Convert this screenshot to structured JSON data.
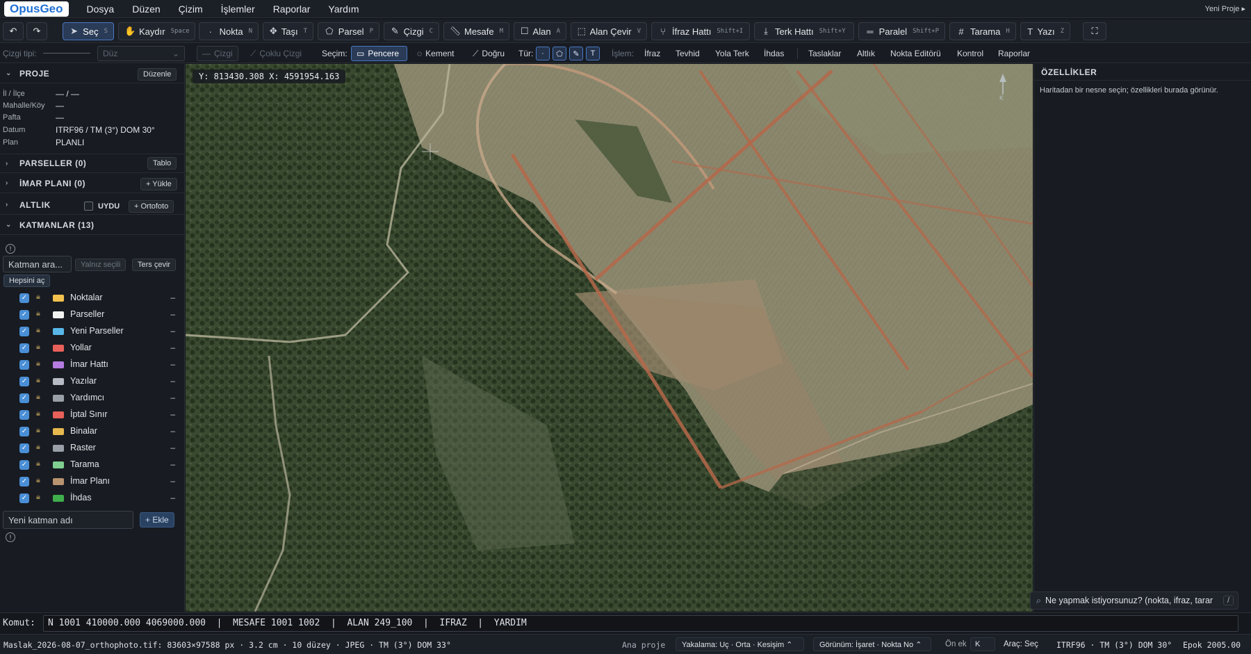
{
  "app": {
    "logo": "OpusGeo",
    "project_name": "Yeni Proje ▸"
  },
  "menu": [
    "Dosya",
    "Düzen",
    "Çizim",
    "İşlemler",
    "Raporlar",
    "Yardım"
  ],
  "toolbar": {
    "undo_icon": "undo-icon",
    "redo_icon": "redo-icon",
    "tools": [
      {
        "label": "Seç",
        "key": "S",
        "icon": "select-arrow-icon",
        "active": true
      },
      {
        "label": "Kaydır",
        "key": "Space",
        "icon": "hand-icon"
      },
      {
        "label": "Nokta",
        "key": "N",
        "icon": "dot-icon"
      },
      {
        "label": "Taşı",
        "key": "T",
        "icon": "move-icon"
      },
      {
        "label": "Parsel",
        "key": "P",
        "icon": "polygon-icon"
      },
      {
        "label": "Çizgi",
        "key": "C",
        "icon": "pencil-icon"
      },
      {
        "label": "Mesafe",
        "key": "M",
        "icon": "ruler-icon"
      },
      {
        "label": "Alan",
        "key": "A",
        "icon": "square-icon"
      },
      {
        "label": "Alan Çevir",
        "key": "V",
        "icon": "dashed-square-icon"
      },
      {
        "label": "İfraz Hattı",
        "key": "Shift+I",
        "icon": "split-icon"
      },
      {
        "label": "Terk Hattı",
        "key": "Shift+Y",
        "icon": "download-icon"
      },
      {
        "label": "Paralel",
        "key": "Shift+P",
        "icon": "parallel-icon"
      },
      {
        "label": "Tarama",
        "key": "H",
        "icon": "hash-icon"
      },
      {
        "label": "Yazı",
        "key": "Z",
        "icon": "text-icon"
      }
    ],
    "fullscreen_icon": "fullscreen-icon"
  },
  "toolbar2": {
    "line_type_label": "Çizgi tipi:",
    "line_style": "Düz",
    "draw_line": "Çizgi",
    "draw_polyline": "Çoklu Çizgi",
    "selection_label": "Seçim:",
    "sel_window": "Pencere",
    "sel_lasso": "Kement",
    "sel_line": "Doğru",
    "type_label": "Tür:",
    "process_label": "İşlem:",
    "ops": [
      "İfraz",
      "Tevhid",
      "Yola Terk",
      "İhdas"
    ],
    "extras": [
      "Taslaklar",
      "Altlık",
      "Nokta Editörü",
      "Kontrol",
      "Raporlar"
    ]
  },
  "sidebar": {
    "project": {
      "title": "PROJE",
      "edit": "Düzenle",
      "fields": [
        {
          "k": "İl / İlçe",
          "v": "— / —"
        },
        {
          "k": "Mahalle/Köy",
          "v": "—"
        },
        {
          "k": "Pafta",
          "v": "—"
        },
        {
          "k": "Datum",
          "v": "ITRF96 / TM (3°) DOM 30°"
        },
        {
          "k": "Plan",
          "v": "PLANLI"
        }
      ]
    },
    "parcels": {
      "title": "PARSELLER (0)",
      "btn": "Tablo"
    },
    "zoning": {
      "title": "İMAR PLANI (0)",
      "btn": "+ Yükle"
    },
    "base": {
      "title": "ALTLIK",
      "sat": "UYDU",
      "btn": "+ Ortofoto"
    },
    "layers": {
      "title": "KATMANLAR (13)",
      "search_placeholder": "Katman ara...",
      "only_selected": "Yalnız seçili",
      "invert": "Ters çevir",
      "open_all": "Hepsini aç",
      "items": [
        {
          "name": "Noktalar",
          "color": "#f2c14e"
        },
        {
          "name": "Parseller",
          "color": "#f2f2f2"
        },
        {
          "name": "Yeni Parseller",
          "color": "#58b7e8"
        },
        {
          "name": "Yollar",
          "color": "#e8605a"
        },
        {
          "name": "İmar Hattı",
          "color": "#b47be0"
        },
        {
          "name": "Yazılar",
          "color": "#b7bcc4"
        },
        {
          "name": "Yardımcı",
          "color": "#9aa0a8"
        },
        {
          "name": "İptal Sınır",
          "color": "#e8605a"
        },
        {
          "name": "Binalar",
          "color": "#e6b94e"
        },
        {
          "name": "Raster",
          "color": "#9aa0a8"
        },
        {
          "name": "Tarama",
          "color": "#7fcf8f"
        },
        {
          "name": "İmar Planı",
          "color": "#b99470"
        },
        {
          "name": "İhdas",
          "color": "#3fae4c"
        }
      ],
      "new_placeholder": "Yeni katman adı",
      "add": "+ Ekle"
    }
  },
  "map": {
    "coord": "Y: 813430.308   X: 4591954.163",
    "north": "K"
  },
  "properties": {
    "title": "ÖZELLİKLER",
    "hint": "Haritadan bir nesne seçin; özellikleri burada görünür."
  },
  "ask": {
    "placeholder": "Ne yapmak istiyorsunuz? (nokta, ifraz, tarar",
    "key": "/"
  },
  "command": {
    "label": "Komut:",
    "value": "N 1001 410000.000 4069000.000  |  MESAFE 1001 1002  |  ALAN 249_100  |  IFRAZ  |  YARDIM"
  },
  "status": {
    "file": "Maslak_2026-08-07_orthophoto.tif: 83603×97588 px · 3.2 cm · 10 düzey · JPEG · TM (3°) DOM 33°",
    "main_project": "Ana proje",
    "snap": "Yakalama: Uç · Orta · Kesişim ⌃",
    "view": "Görünüm: İşaret · Nokta No ⌃",
    "prefix_label": "Ön ek",
    "prefix_value": "K",
    "tool": "Araç: Seç",
    "crs": "ITRF96 · TM (3°) DOM 30°",
    "epoch": "Epok 2005.00"
  }
}
